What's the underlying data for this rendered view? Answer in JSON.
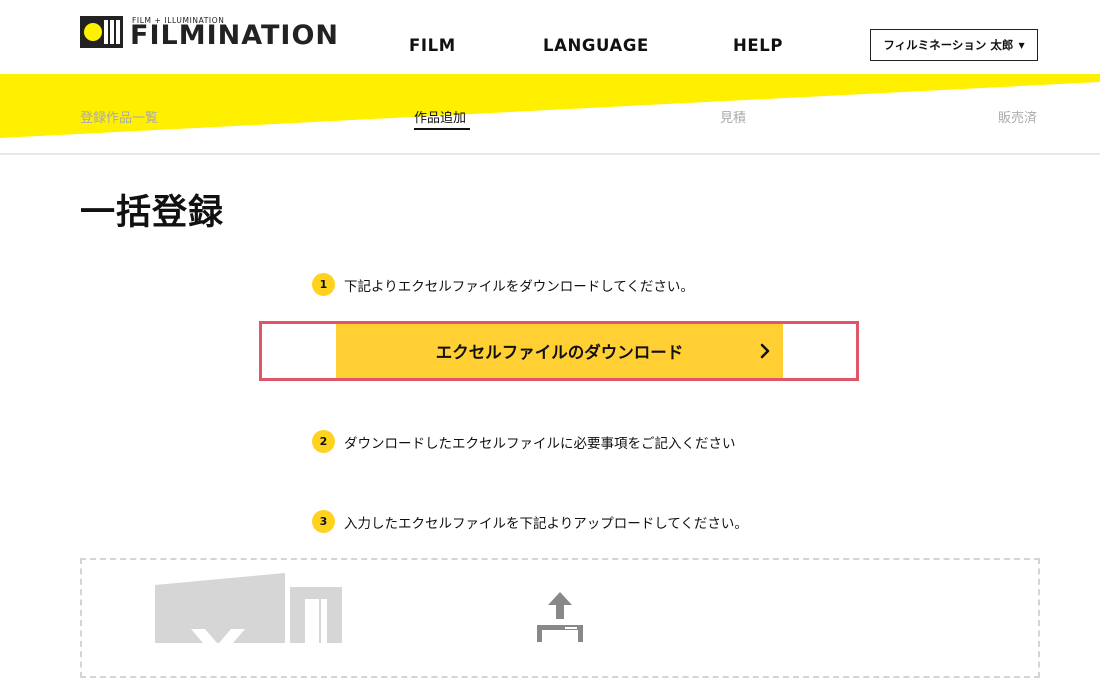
{
  "brand": {
    "tagline": "FILM + ILLUMINATION",
    "name": "FILMINATION"
  },
  "nav": {
    "film": "FILM",
    "language": "LANGUAGE",
    "help": "HELP"
  },
  "user": {
    "name": "フィルミネーション 太郎",
    "caret": "▼"
  },
  "subnav": {
    "list": "登録作品一覧",
    "add": "作品追加",
    "estimate": "見積",
    "sold": "販売済"
  },
  "page": {
    "title": "一括登録"
  },
  "steps": [
    {
      "num": "1",
      "text": "下記よりエクセルファイルをダウンロードしてください。"
    },
    {
      "num": "2",
      "text": "ダウンロードしたエクセルファイルに必要事項をご記入ください"
    },
    {
      "num": "3",
      "text": "入力したエクセルファイルを下記よりアップロードしてください。"
    }
  ],
  "download": {
    "label": "エクセルファイルのダウンロード"
  },
  "colors": {
    "accent_yellow": "#fff000",
    "button_yellow": "#ffcf33",
    "highlight_red": "#e05569",
    "step_badge": "#ffd21f"
  }
}
